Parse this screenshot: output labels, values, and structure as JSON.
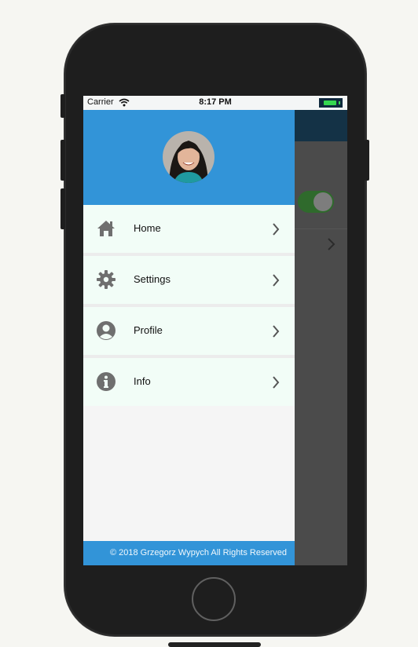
{
  "status_bar": {
    "carrier": "Carrier",
    "time": "8:17 PM",
    "wifi_icon": "wifi-icon",
    "battery_icon": "battery-icon"
  },
  "drawer": {
    "avatar_icon": "avatar-photo",
    "items": [
      {
        "label": "Home",
        "icon": "home-icon"
      },
      {
        "label": "Settings",
        "icon": "gear-icon"
      },
      {
        "label": "Profile",
        "icon": "user-circle-icon"
      },
      {
        "label": "Info",
        "icon": "info-icon"
      }
    ],
    "footer": "© 2018 Grzegorz Wypych All Rights Reserved"
  },
  "background_app": {
    "toggle_state": "on"
  },
  "colors": {
    "accent": "#3294d8",
    "menu_bg": "#f2fdf7",
    "toggle_green": "#2f6a2c"
  }
}
